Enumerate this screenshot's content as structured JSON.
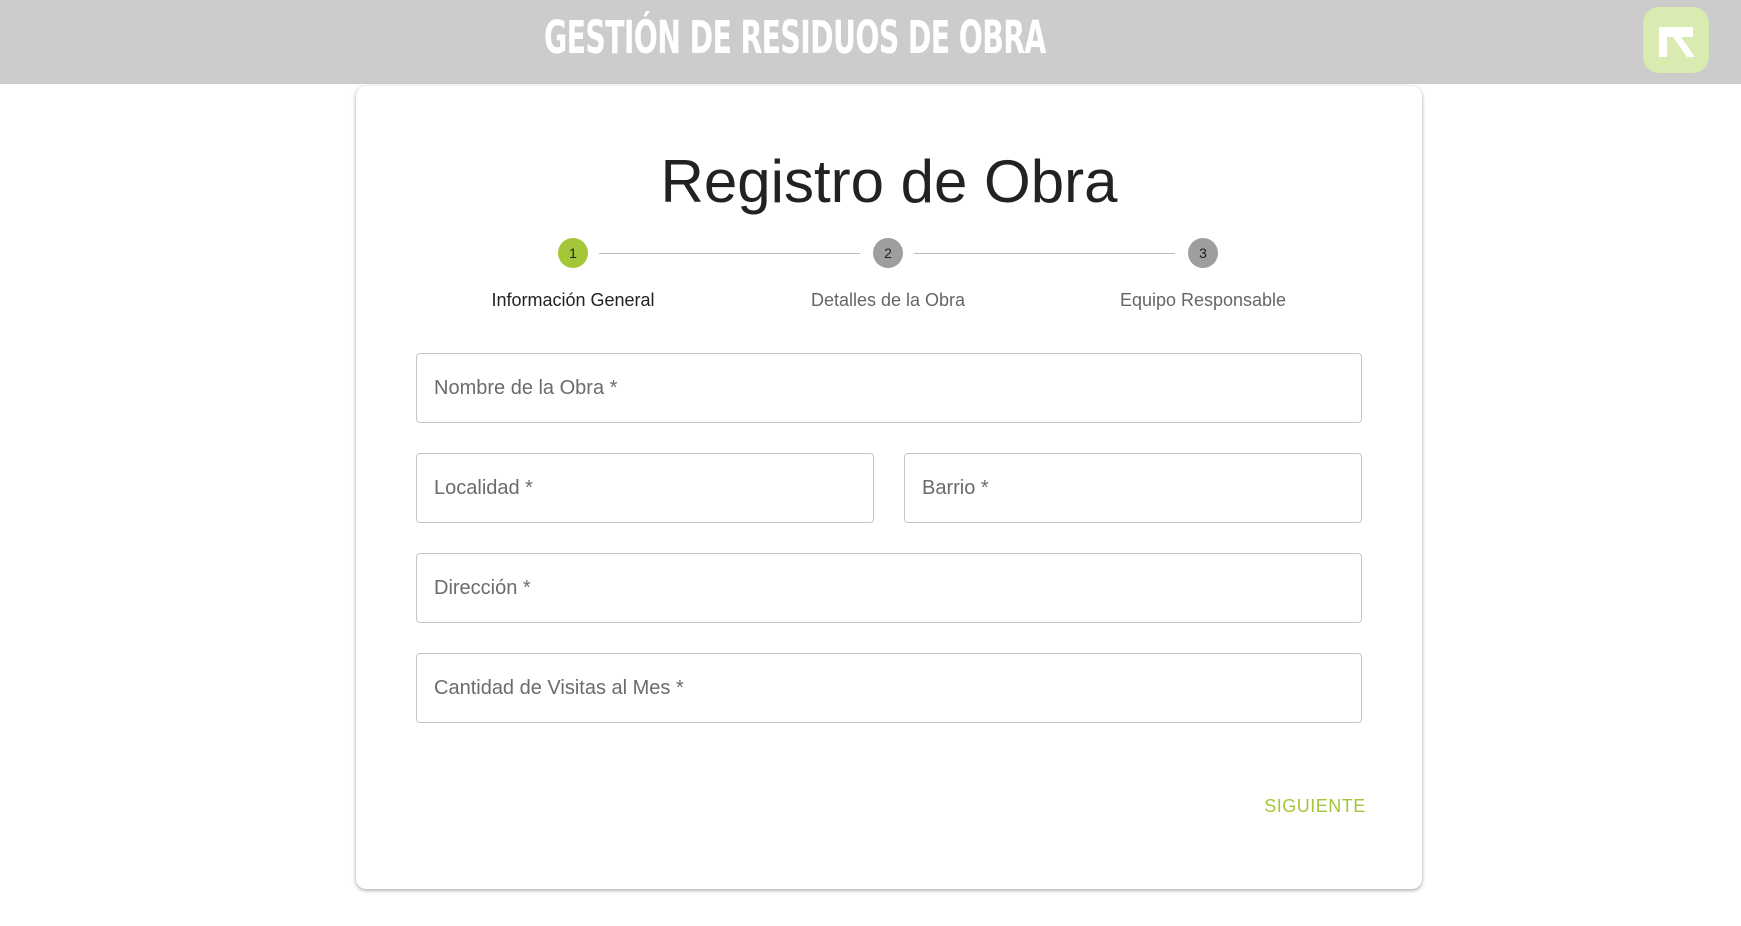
{
  "header": {
    "title": "GESTIÓN DE RESIDUOS DE OBRA",
    "logo_icon": "arrow-corner-logo-icon",
    "bar_color": "#cccccc",
    "logo_color": "#d9ebb0"
  },
  "form": {
    "title": "Registro de Obra",
    "steps": [
      {
        "number": "1",
        "label": "Información General",
        "active": true
      },
      {
        "number": "2",
        "label": "Detalles de la Obra",
        "active": false
      },
      {
        "number": "3",
        "label": "Equipo Responsable",
        "active": false
      }
    ],
    "fields": {
      "nombre": {
        "placeholder": "Nombre de la Obra *",
        "value": ""
      },
      "localidad": {
        "placeholder": "Localidad *",
        "value": ""
      },
      "barrio": {
        "placeholder": "Barrio *",
        "value": ""
      },
      "direccion": {
        "placeholder": "Dirección *",
        "value": ""
      },
      "visitas": {
        "placeholder": "Cantidad de Visitas al Mes *",
        "value": ""
      }
    },
    "next_label": "SIGUIENTE",
    "accent_color": "#a4c639"
  }
}
